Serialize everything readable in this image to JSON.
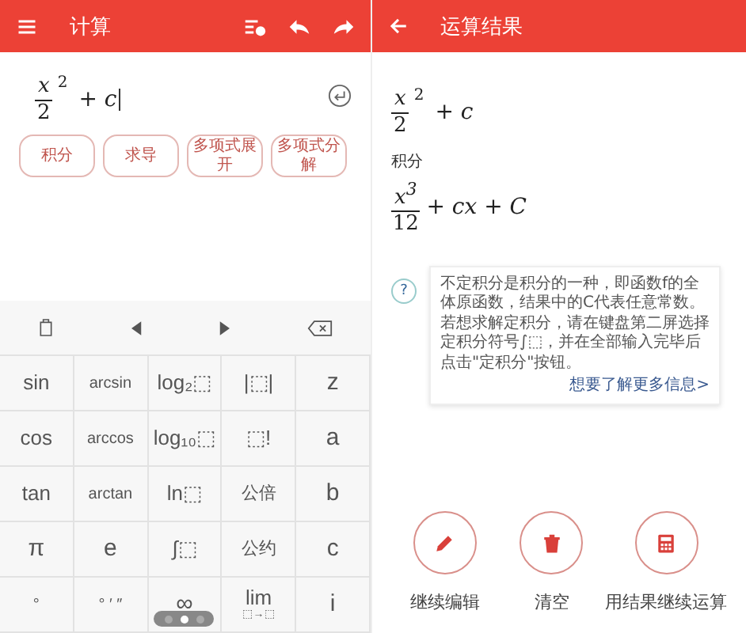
{
  "left": {
    "title": "计算",
    "input": [
      {
        "kind": "frac",
        "num": "x",
        "den": "2"
      },
      {
        "kind": "sup",
        "text": "2"
      },
      {
        "kind": "text",
        "text": "+ c"
      }
    ],
    "actions": [
      "积分",
      "求导",
      "多项式展开",
      "多项式分解"
    ],
    "keyboard": {
      "rows": [
        [
          {
            "label": "sin",
            "kind": "func"
          },
          {
            "label": "arcsin",
            "kind": "small"
          },
          {
            "label": "log₂⬚",
            "kind": "func"
          },
          {
            "label": "|⬚|",
            "kind": "func"
          },
          {
            "label": "z",
            "kind": "var"
          }
        ],
        [
          {
            "label": "cos",
            "kind": "func"
          },
          {
            "label": "arccos",
            "kind": "small"
          },
          {
            "label": "log₁₀⬚",
            "kind": "func"
          },
          {
            "label": "⬚!",
            "kind": "func"
          },
          {
            "label": "a",
            "kind": "var"
          }
        ],
        [
          {
            "label": "tan",
            "kind": "func"
          },
          {
            "label": "arctan",
            "kind": "small"
          },
          {
            "label": "ln⬚",
            "kind": "func"
          },
          {
            "label": "公倍",
            "kind": "cjk"
          },
          {
            "label": "b",
            "kind": "var"
          }
        ],
        [
          {
            "label": "π",
            "kind": "var"
          },
          {
            "label": "e",
            "kind": "var"
          },
          {
            "label": "∫⬚",
            "kind": "func"
          },
          {
            "label": "公约",
            "kind": "cjk"
          },
          {
            "label": "c",
            "kind": "var"
          }
        ],
        [
          {
            "label": "°",
            "kind": "small"
          },
          {
            "label": "° ′ ″",
            "kind": "small"
          },
          {
            "label": "∞",
            "kind": "var"
          },
          {
            "label": "lim",
            "sub": "⬚→⬚",
            "kind": "func"
          },
          {
            "label": "i",
            "kind": "var"
          }
        ]
      ],
      "page_indicator": [
        {
          "selected": false
        },
        {
          "selected": true
        },
        {
          "selected": false
        }
      ]
    }
  },
  "right": {
    "title": "运算结果",
    "expression": [
      {
        "kind": "frac",
        "num": "x",
        "den": "2"
      },
      {
        "kind": "sup",
        "text": "2"
      },
      {
        "kind": "text",
        "text": "+ c"
      }
    ],
    "operation": "积分",
    "result": [
      {
        "kind": "frac",
        "num": "x$^{3}$",
        "den": "12"
      },
      {
        "kind": "text",
        "text": "+ cx + C"
      }
    ],
    "help": {
      "icon": "?",
      "text": "不定积分是积分的一种，即函数f的全体原函数，结果中的C代表任意常数。若想求解定积分，请在键盘第二屏选择定积分符号∫⬚，并在全部输入完毕后点击\"定积分\"按钮。",
      "link": "想要了解更多信息>"
    },
    "buttons": [
      {
        "label": "继续编辑",
        "kind": "edit"
      },
      {
        "label": "清空",
        "kind": "clear"
      },
      {
        "label": "用结果继续运算",
        "kind": "calc"
      }
    ]
  }
}
